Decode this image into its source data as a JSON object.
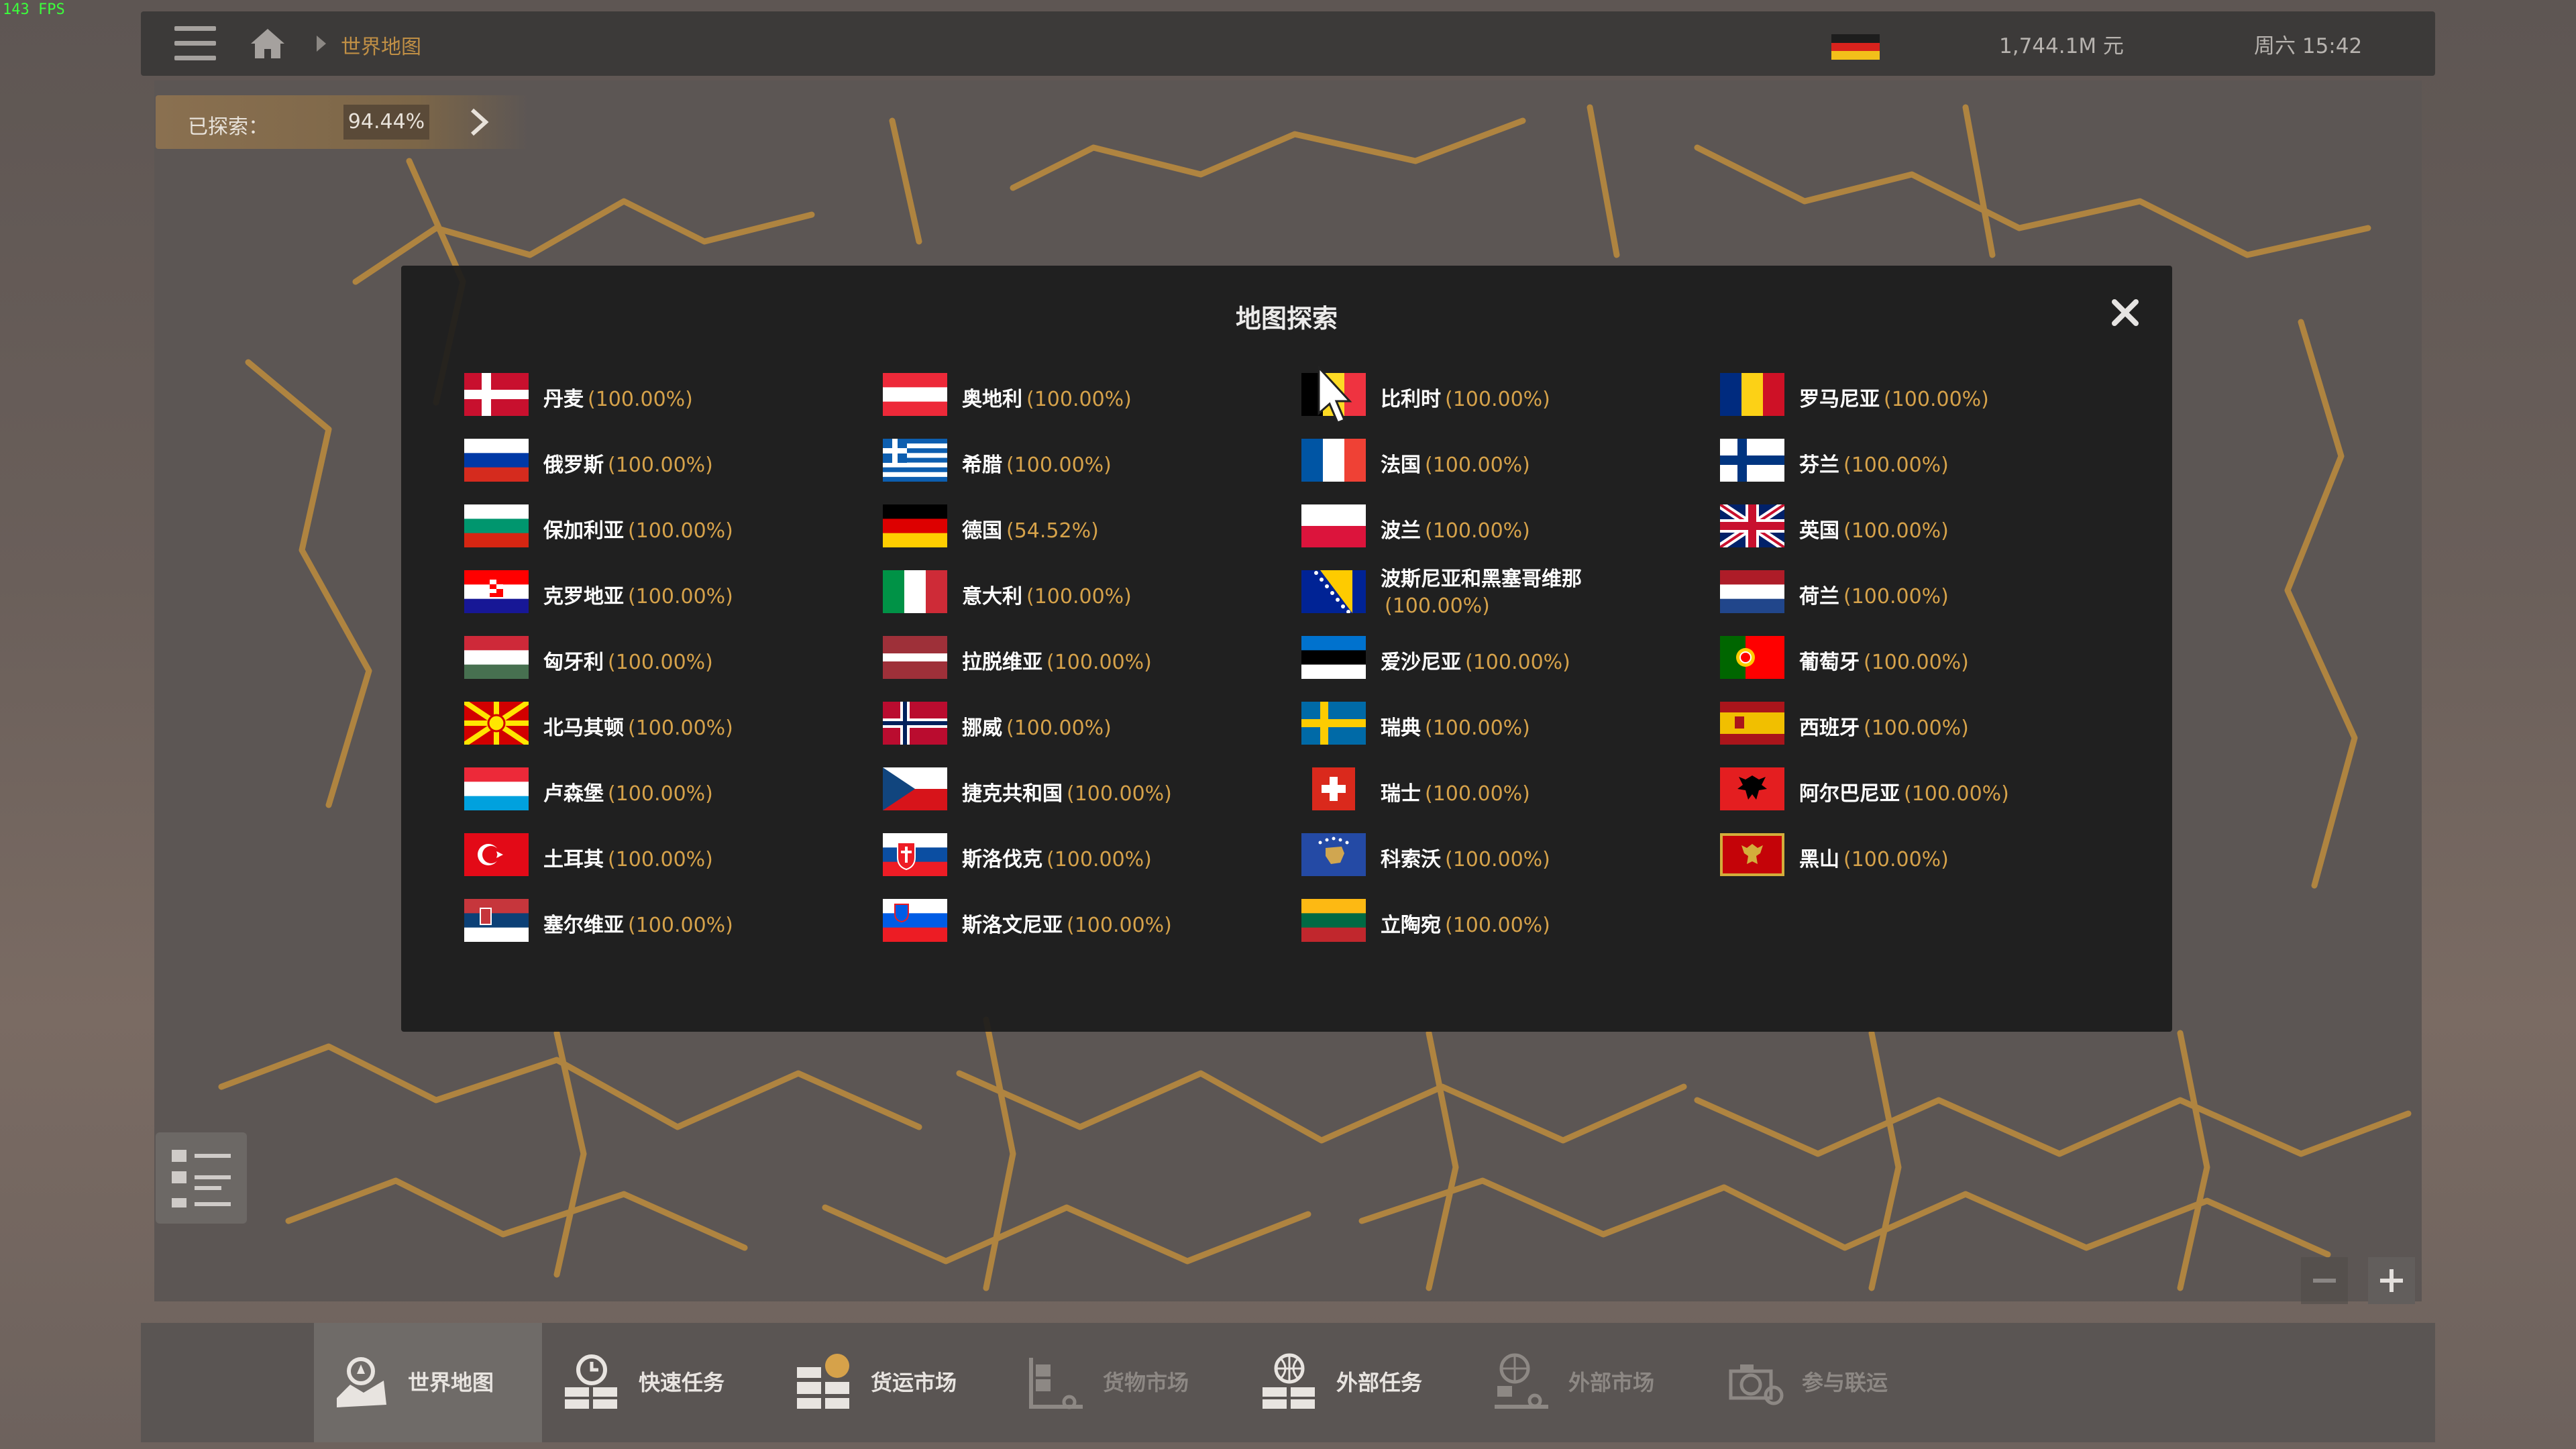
{
  "fps": "143 FPS",
  "header": {
    "breadcrumb": "世界地图",
    "money": "1,744.1M 元",
    "clock": "周六 15:42"
  },
  "explored": {
    "label": "已探索：",
    "value": "94.44%"
  },
  "modal": {
    "title": "地图探索",
    "countries": [
      {
        "name": "丹麦",
        "pct": "(100.00%)",
        "flag": "denmark"
      },
      {
        "name": "俄罗斯",
        "pct": "(100.00%)",
        "flag": "russia"
      },
      {
        "name": "保加利亚",
        "pct": "(100.00%)",
        "flag": "bulgaria"
      },
      {
        "name": "克罗地亚",
        "pct": "(100.00%)",
        "flag": "croatia"
      },
      {
        "name": "匈牙利",
        "pct": "(100.00%)",
        "flag": "hungary"
      },
      {
        "name": "北马其顿",
        "pct": "(100.00%)",
        "flag": "north-macedonia"
      },
      {
        "name": "卢森堡",
        "pct": "(100.00%)",
        "flag": "luxembourg"
      },
      {
        "name": "土耳其",
        "pct": "(100.00%)",
        "flag": "turkey"
      },
      {
        "name": "塞尔维亚",
        "pct": "(100.00%)",
        "flag": "serbia"
      },
      {
        "name": "奥地利",
        "pct": "(100.00%)",
        "flag": "austria"
      },
      {
        "name": "希腊",
        "pct": "(100.00%)",
        "flag": "greece"
      },
      {
        "name": "德国",
        "pct": "(54.52%)",
        "flag": "germany"
      },
      {
        "name": "意大利",
        "pct": "(100.00%)",
        "flag": "italy"
      },
      {
        "name": "拉脱维亚",
        "pct": "(100.00%)",
        "flag": "latvia"
      },
      {
        "name": "挪威",
        "pct": "(100.00%)",
        "flag": "norway"
      },
      {
        "name": "捷克共和国",
        "pct": "(100.00%)",
        "flag": "czech"
      },
      {
        "name": "斯洛伐克",
        "pct": "(100.00%)",
        "flag": "slovakia"
      },
      {
        "name": "斯洛文尼亚",
        "pct": "(100.00%)",
        "flag": "slovenia"
      },
      {
        "name": "比利时",
        "pct": "(100.00%)",
        "flag": "belgium"
      },
      {
        "name": "法国",
        "pct": "(100.00%)",
        "flag": "france"
      },
      {
        "name": "波兰",
        "pct": "(100.00%)",
        "flag": "poland"
      },
      {
        "name": "波斯尼亚和黑塞哥维那",
        "pct": "(100.00%)",
        "flag": "bosnia"
      },
      {
        "name": "爱沙尼亚",
        "pct": "(100.00%)",
        "flag": "estonia"
      },
      {
        "name": "瑞典",
        "pct": "(100.00%)",
        "flag": "sweden"
      },
      {
        "name": "瑞士",
        "pct": "(100.00%)",
        "flag": "switzerland"
      },
      {
        "name": "科索沃",
        "pct": "(100.00%)",
        "flag": "kosovo"
      },
      {
        "name": "立陶宛",
        "pct": "(100.00%)",
        "flag": "lithuania"
      },
      {
        "name": "罗马尼亚",
        "pct": "(100.00%)",
        "flag": "romania"
      },
      {
        "name": "芬兰",
        "pct": "(100.00%)",
        "flag": "finland"
      },
      {
        "name": "英国",
        "pct": "(100.00%)",
        "flag": "uk"
      },
      {
        "name": "荷兰",
        "pct": "(100.00%)",
        "flag": "netherlands"
      },
      {
        "name": "葡萄牙",
        "pct": "(100.00%)",
        "flag": "portugal"
      },
      {
        "name": "西班牙",
        "pct": "(100.00%)",
        "flag": "spain"
      },
      {
        "name": "阿尔巴尼亚",
        "pct": "(100.00%)",
        "flag": "albania"
      },
      {
        "name": "黑山",
        "pct": "(100.00%)",
        "flag": "montenegro"
      }
    ]
  },
  "tabs": [
    {
      "label": "世界地图",
      "active": true,
      "enabled": true,
      "icon": "world-map-icon"
    },
    {
      "label": "快速任务",
      "active": false,
      "enabled": true,
      "icon": "quick-job-icon"
    },
    {
      "label": "货运市场",
      "active": false,
      "enabled": true,
      "icon": "freight-market-icon"
    },
    {
      "label": "货物市场",
      "active": false,
      "enabled": false,
      "icon": "cargo-market-icon"
    },
    {
      "label": "外部任务",
      "active": false,
      "enabled": true,
      "icon": "external-jobs-icon"
    },
    {
      "label": "外部市场",
      "active": false,
      "enabled": false,
      "icon": "external-market-icon"
    },
    {
      "label": "参与联运",
      "active": false,
      "enabled": false,
      "icon": "convoy-icon"
    }
  ],
  "colors": {
    "accent": "#d6a24a",
    "road": "#b8893e",
    "tab_enabled": "#e8e4e0",
    "tab_disabled": "#8d8884"
  }
}
